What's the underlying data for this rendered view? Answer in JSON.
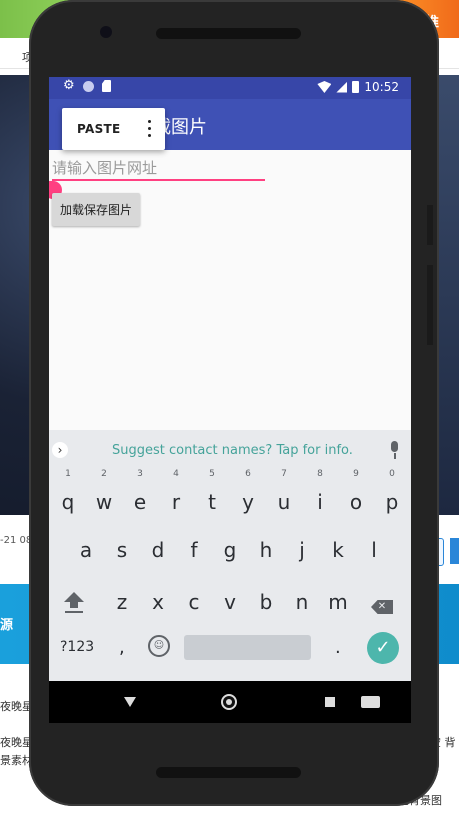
{
  "background": {
    "nav_text": "项",
    "logo_right_text": "推",
    "date_text": "-21 08",
    "blue_banner_text": "源",
    "lines": [
      "夜晚星",
      "夜晚星",
      "景素材",
      "空 背",
      "空背景图"
    ]
  },
  "statusbar": {
    "time": "10:52"
  },
  "appbar": {
    "title": "载图片"
  },
  "context_menu": {
    "paste_label": "PASTE"
  },
  "form": {
    "url_placeholder": "请输入图片网址",
    "load_button_label": "加载保存图片"
  },
  "keyboard": {
    "suggestion_text": "Suggest contact names? Tap for info.",
    "row1": [
      "q",
      "w",
      "e",
      "r",
      "t",
      "y",
      "u",
      "i",
      "o",
      "p"
    ],
    "row1_hints": [
      "1",
      "2",
      "3",
      "4",
      "5",
      "6",
      "7",
      "8",
      "9",
      "0"
    ],
    "row2": [
      "a",
      "s",
      "d",
      "f",
      "g",
      "h",
      "j",
      "k",
      "l"
    ],
    "row3": [
      "z",
      "x",
      "c",
      "v",
      "b",
      "n",
      "m"
    ],
    "symbols_label": "?123",
    "comma": ",",
    "period": "."
  },
  "colors": {
    "primary": "#3f51b5",
    "primary_dark": "#3746a8",
    "accent": "#ff4081",
    "suggest_text": "#45a39a",
    "done_key": "#4db6ac"
  },
  "icons": [
    "gear-icon",
    "circle-icon",
    "sd-card-icon",
    "wifi-icon",
    "signal-icon",
    "battery-icon",
    "more-vert-icon",
    "expand-arrow-icon",
    "mic-icon",
    "shift-icon",
    "backspace-icon",
    "emoji-icon",
    "checkmark-icon",
    "back-icon",
    "home-icon",
    "recents-icon",
    "keyboard-icon"
  ]
}
